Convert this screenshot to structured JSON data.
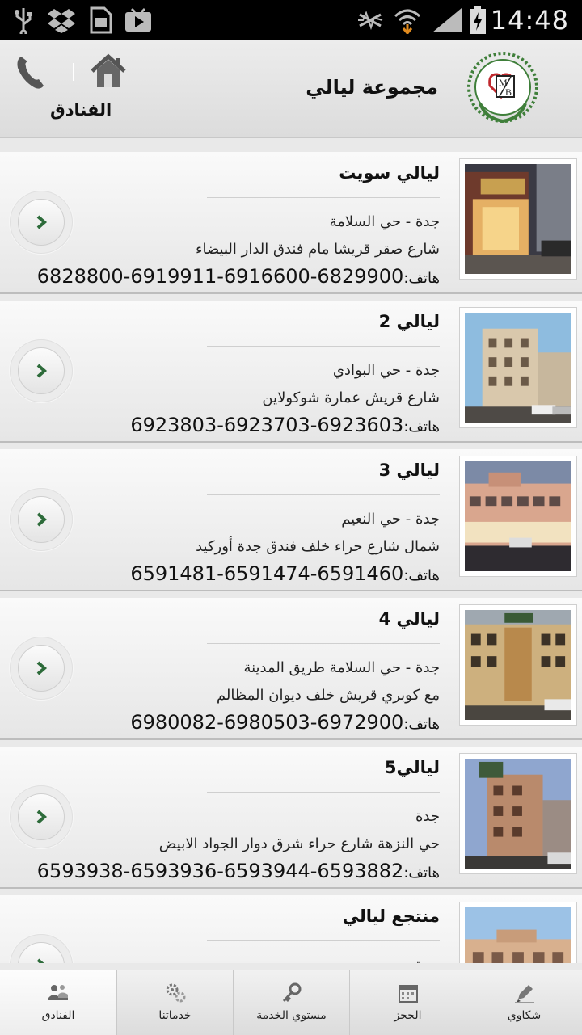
{
  "status_bar": {
    "time": "14:48",
    "icons": [
      "usb-icon",
      "dropbox-icon",
      "sim-icon",
      "play-store-icon",
      "mute-icon",
      "wifi-icon",
      "signal-icon",
      "battery-charging-icon"
    ]
  },
  "header": {
    "title": "مجموعة ليالي",
    "section": "الفنادق",
    "icons": [
      "phone-icon",
      "home-icon",
      "logo"
    ]
  },
  "hotels": [
    {
      "name": "ليالي سويت",
      "line1": "جدة - حي السلامة",
      "line2": "شارع صقر قريشا مام فندق الدار البيضاء",
      "phone_label": "هاتف:",
      "phones": "6828800-6919911-6916600-6829900"
    },
    {
      "name": "ليالي 2",
      "line1": "جدة - حي البوادي",
      "line2": "شارع قريش عمارة شوكولاين",
      "phone_label": "هاتف:",
      "phones": "6923803-6923703-6923603"
    },
    {
      "name": "ليالي 3",
      "line1": "جدة - حي النعيم",
      "line2": "شمال شارع حراء خلف فندق جدة أوركيد",
      "phone_label": "هاتف:",
      "phones": "6591481-6591474-6591460"
    },
    {
      "name": "ليالي 4",
      "line1": "جدة - حي السلامة طريق المدينة",
      "line2": "مع كوبري قريش خلف ديوان المظالم",
      "phone_label": "هاتف:",
      "phones": "6980082-6980503-6972900"
    },
    {
      "name": "ليالي5",
      "line1": "جدة",
      "line2": "حي النزهة شارع حراء شرق دوار الجواد الابيض",
      "phone_label": "هاتف:",
      "phones": "6593938-6593936-6593944-6593882"
    },
    {
      "name": "منتجع ليالي",
      "line1": "جدة",
      "line2": "",
      "phone_label": "",
      "phones": ""
    }
  ],
  "bottom_nav": [
    {
      "label": "الفنادق",
      "icon": "hotels-icon",
      "active": true
    },
    {
      "label": "خدماتنا",
      "icon": "gears-icon",
      "active": false
    },
    {
      "label": "مستوي الخدمة",
      "icon": "key-icon",
      "active": false
    },
    {
      "label": "الحجز",
      "icon": "calendar-icon",
      "active": false
    },
    {
      "label": "شكاوي",
      "icon": "pen-icon",
      "active": false
    }
  ],
  "colors": {
    "accent": "#2d6b3a",
    "header_bg": "#e3e3e3",
    "card_bg": "#f2f2f2",
    "status_bar": "#000000"
  }
}
